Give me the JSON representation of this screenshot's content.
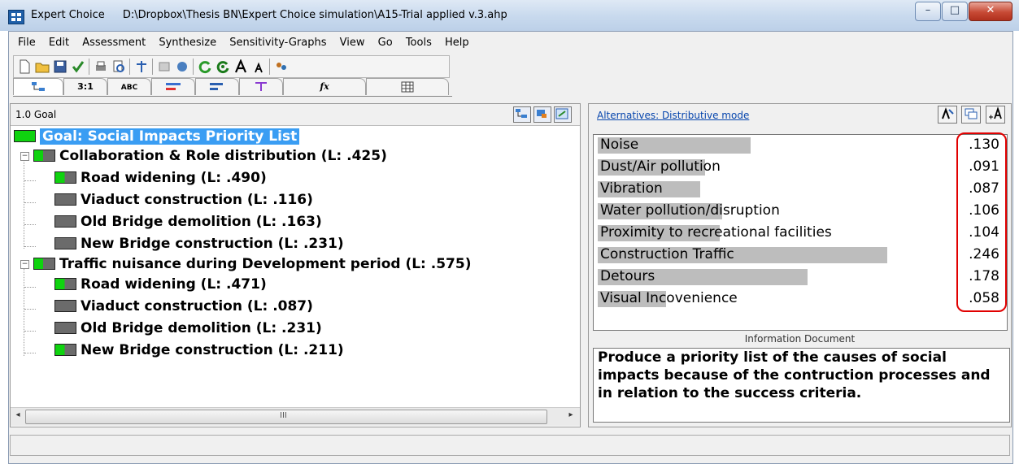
{
  "window": {
    "app_name": "Expert Choice",
    "file_path": "D:\\Dropbox\\Thesis BN\\Expert Choice simulation\\A15-Trial applied v.3.ahp",
    "controls": {
      "minimize": "–",
      "maximize": "□",
      "close": "✕"
    }
  },
  "menu": [
    "File",
    "Edit",
    "Assessment",
    "Synthesize",
    "Sensitivity-Graphs",
    "View",
    "Go",
    "Tools",
    "Help"
  ],
  "tabs": [
    "tree-view",
    "3:1",
    "ABC",
    "bar-red",
    "bar-blue",
    "flow",
    "fx",
    "grid"
  ],
  "tab_labels": {
    "ratio": "3:1",
    "abc": "ABC",
    "fx": "fx"
  },
  "tree_pane": {
    "header": "1.0 Goal",
    "goal": "Goal: Social Impacts Priority List",
    "criteria": [
      {
        "label": "Collaboration & Role distribution (L: .425)",
        "alternatives": [
          "Road widening (L: .490)",
          "Viaduct construction (L: .116)",
          "Old Bridge demolition (L: .163)",
          "New Bridge construction (L: .231)"
        ]
      },
      {
        "label": "Traffic nuisance during Development period (L: .575)",
        "alternatives": [
          "Road widening (L: .471)",
          "Viaduct construction (L: .087)",
          "Old Bridge demolition (L: .231)",
          "New Bridge construction (L: .211)"
        ]
      }
    ],
    "scroll_grip": "III"
  },
  "alternatives_pane": {
    "mode_link": "Alternatives: Distributive mode",
    "items": [
      {
        "name": "Noise",
        "value": ".130",
        "fraction": 0.13
      },
      {
        "name": "Dust/Air pollution",
        "value": ".091",
        "fraction": 0.091
      },
      {
        "name": "Vibration",
        "value": ".087",
        "fraction": 0.087
      },
      {
        "name": "Water pollution/disruption",
        "value": ".106",
        "fraction": 0.106
      },
      {
        "name": "Proximity to recreational facilities",
        "value": ".104",
        "fraction": 0.104
      },
      {
        "name": "Construction Traffic",
        "value": ".246",
        "fraction": 0.246
      },
      {
        "name": "Detours",
        "value": ".178",
        "fraction": 0.178
      },
      {
        "name": "Visual Incovenience",
        "value": ".058",
        "fraction": 0.058
      }
    ],
    "info_title": "Information Document",
    "info_text": "Produce a priority list of the causes of social impacts because of the contruction processes and in relation to the success criteria."
  },
  "colors": {
    "node_green": "#0fd30f",
    "node_gray": "#6b6b6b",
    "goal_highlight": "#3a9df3",
    "annotation_red": "#e10000",
    "bar_gray": "#bdbdbd"
  }
}
